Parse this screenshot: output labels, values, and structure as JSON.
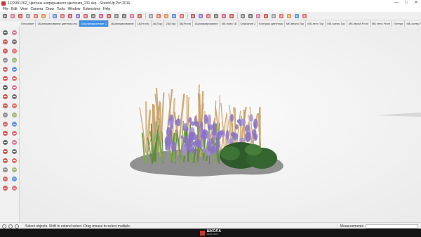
{
  "window": {
    "title": "1133391262_Цветник непрерывного цветения_231.skp - SketchUp Pro 2016",
    "controls": [
      "—",
      "□",
      "✕"
    ]
  },
  "menu": [
    "File",
    "Edit",
    "View",
    "Camera",
    "Draw",
    "Tools",
    "Window",
    "Extensions",
    "Help"
  ],
  "toolbar_icons": [
    "select-arrow-icon",
    "eraser-icon",
    "pencil-line-icon",
    "dropdown-icon",
    "rectangle-icon",
    "paint-bucket-icon",
    "push-pull-icon",
    "move-icon",
    "rotate-icon",
    "scale-icon",
    "offset-icon",
    "tape-measure-icon",
    "text-icon",
    "axes-icon",
    "orbit-icon",
    "pan-icon",
    "zoom-icon",
    "zoom-extents-icon",
    "warehouse-icon",
    "extension-icon",
    "layout-icon",
    "style-icon",
    "section-icon",
    "iso-view-icon",
    "top-view-icon",
    "front-view-icon",
    "right-view-icon",
    "back-view-icon",
    "left-view-icon",
    "xray-icon",
    "wireframe-icon",
    "hidden-line-icon",
    "shaded-icon",
    "textured-icon",
    "monochrome-icon",
    "house-icon",
    "house-outline-icon",
    "group-icon"
  ],
  "scene_tabs": [
    "Описание",
    "1Б(анимирование цветник оло",
    "1Б(анимирование С",
    "1Б(анимирование",
    "1Б(Front)",
    "1Б(Top)",
    "2Б(Top)",
    "3Б(Front)",
    "1Б(анимирование",
    "МБ план 1Б",
    "Описание 2",
    "Контуры цветника",
    "МБ весна Top",
    "МБ лето Top",
    "МБ осень Top",
    "МБ весна Front",
    "МБ лето Front",
    "Потеря",
    "МБ осень Front",
    "▸"
  ],
  "active_scene_index": 2,
  "status": {
    "text": "Select objects. Shift to extend select. Drag mouse to select multiple.",
    "measurements_label": "Measurements"
  },
  "logo": {
    "line1": "ШКОЛА",
    "line2": "SKETCHUP"
  },
  "colors": {
    "accent": "#3d8ee6",
    "grass_tan": "#c9a06a",
    "lavender": "#8a72c4",
    "shrub_green": "#2f5a2c"
  }
}
